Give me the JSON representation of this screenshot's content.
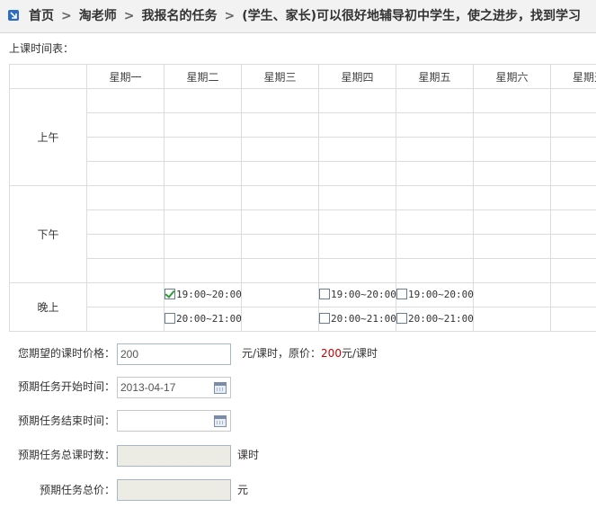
{
  "breadcrumb": {
    "items": [
      "首页",
      "淘老师",
      "我报名的任务",
      "(学生、家长)可以很好地辅导初中学生，使之进步，找到学习"
    ],
    "separator": ">"
  },
  "schedule": {
    "label": "上课时间表：",
    "days": [
      "星期一",
      "星期二",
      "星期三",
      "星期四",
      "星期五",
      "星期六",
      "星期天"
    ],
    "periods": {
      "morning": "上午",
      "afternoon": "下午",
      "evening": "晚上"
    },
    "evening_rows": [
      [
        {
          "time": "",
          "checked": false,
          "show": false
        },
        {
          "time": "19:00~20:00",
          "checked": true,
          "show": true
        },
        {
          "time": "",
          "checked": false,
          "show": false
        },
        {
          "time": "19:00~20:00",
          "checked": false,
          "show": true
        },
        {
          "time": "19:00~20:00",
          "checked": false,
          "show": true
        },
        {
          "time": "",
          "checked": false,
          "show": false
        },
        {
          "time": "",
          "checked": false,
          "show": false
        }
      ],
      [
        {
          "time": "",
          "checked": false,
          "show": false
        },
        {
          "time": "20:00~21:00",
          "checked": false,
          "show": true
        },
        {
          "time": "",
          "checked": false,
          "show": false
        },
        {
          "time": "20:00~21:00",
          "checked": false,
          "show": true
        },
        {
          "time": "20:00~21:00",
          "checked": false,
          "show": true
        },
        {
          "time": "",
          "checked": false,
          "show": false
        },
        {
          "time": "",
          "checked": false,
          "show": false
        }
      ]
    ]
  },
  "form": {
    "price": {
      "label": "您期望的课时价格：",
      "value": "200",
      "unit": "元/课时，原价：",
      "orig_price": "200",
      "orig_unit": "元/课时"
    },
    "start": {
      "label": "预期任务开始时间：",
      "value": "2013-04-17"
    },
    "end": {
      "label": "预期任务结束时间：",
      "value": ""
    },
    "hours": {
      "label": "预期任务总课时数：",
      "value": "",
      "unit": "课时"
    },
    "total": {
      "label": "预期任务总价：",
      "value": "",
      "unit": "元"
    }
  },
  "colors": {
    "accent": "#2b6cc4",
    "price_highlight": "#cc0000",
    "check": "#2e9a3a"
  }
}
